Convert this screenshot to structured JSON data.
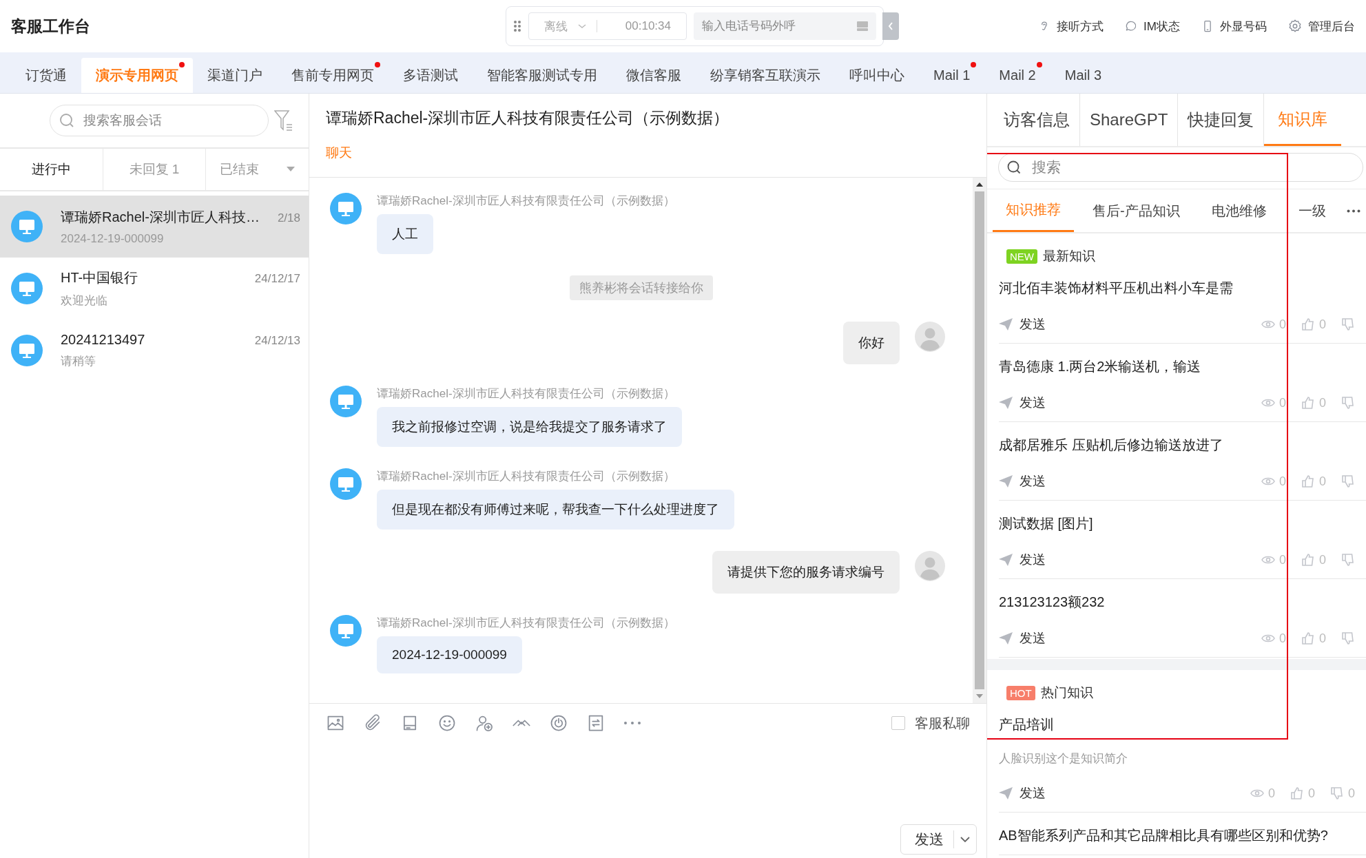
{
  "app_title": "客服工作台",
  "call_bar": {
    "status": "离线",
    "timer": "00:10:34",
    "phone_placeholder": "输入电话号码外呼"
  },
  "header_actions": [
    {
      "kind": "ear",
      "label": "接听方式"
    },
    {
      "kind": "chat",
      "label": "IM状态"
    },
    {
      "kind": "phone",
      "label": "外显号码"
    },
    {
      "kind": "gear",
      "label": "管理后台"
    }
  ],
  "tabs": [
    {
      "label": "订货通",
      "selected": false,
      "unread": false
    },
    {
      "label": "演示专用网页",
      "selected": true,
      "unread": true
    },
    {
      "label": "渠道门户",
      "selected": false,
      "unread": false
    },
    {
      "label": "售前专用网页",
      "selected": false,
      "unread": true
    },
    {
      "label": "多语测试",
      "selected": false,
      "unread": false
    },
    {
      "label": "智能客服测试专用",
      "selected": false,
      "unread": false
    },
    {
      "label": "微信客服",
      "selected": false,
      "unread": false
    },
    {
      "label": "纷享销客互联演示",
      "selected": false,
      "unread": false
    },
    {
      "label": "呼叫中心",
      "selected": false,
      "unread": false
    },
    {
      "label": "Mail 1",
      "selected": false,
      "unread": true
    },
    {
      "label": "Mail 2",
      "selected": false,
      "unread": true
    },
    {
      "label": "Mail 3",
      "selected": false,
      "unread": false
    }
  ],
  "sidebar": {
    "search_placeholder": "搜索客服会话",
    "filters": [
      {
        "label": "进行中",
        "selected": true,
        "dropdown": false
      },
      {
        "label": "未回复 1",
        "selected": false,
        "dropdown": false
      },
      {
        "label": "已结束",
        "selected": false,
        "dropdown": true
      }
    ],
    "conversations": [
      {
        "name": "谭瑞娇Rachel-深圳市匠人科技…",
        "date": "2/18",
        "preview": "2024-12-19-000099",
        "selected": true
      },
      {
        "name": "HT-中国银行",
        "date": "24/12/17",
        "preview": "欢迎光临",
        "selected": false
      },
      {
        "name": "20241213497",
        "date": "24/12/13",
        "preview": "请稍等",
        "selected": false
      }
    ]
  },
  "chat": {
    "title": "谭瑞娇Rachel-深圳市匠人科技有限责任公司（示例数据）",
    "tab": "聊天",
    "messages": [
      {
        "kind": "incoming",
        "sender": "谭瑞娇Rachel-深圳市匠人科技有限责任公司（示例数据）",
        "text": "人工"
      },
      {
        "kind": "system",
        "text": "熊养彬将会话转接给你"
      },
      {
        "kind": "outgoing",
        "text": "你好"
      },
      {
        "kind": "incoming",
        "sender": "谭瑞娇Rachel-深圳市匠人科技有限责任公司（示例数据）",
        "text": "我之前报修过空调，说是给我提交了服务请求了"
      },
      {
        "kind": "incoming",
        "sender": "谭瑞娇Rachel-深圳市匠人科技有限责任公司（示例数据）",
        "text": "但是现在都没有师傅过来呢，帮我查一下什么处理进度了"
      },
      {
        "kind": "outgoing",
        "text": "请提供下您的服务请求编号"
      },
      {
        "kind": "incoming",
        "sender": "谭瑞娇Rachel-深圳市匠人科技有限责任公司（示例数据）",
        "text": "2024-12-19-000099"
      }
    ],
    "private_chat": {
      "label": "客服私聊",
      "checked": false
    },
    "send_label": "发送"
  },
  "side_panel": {
    "tabs": [
      {
        "label": "访客信息",
        "selected": false
      },
      {
        "label": "ShareGPT",
        "selected": false
      },
      {
        "label": "快捷回复",
        "selected": false
      },
      {
        "label": "知识库",
        "selected": true
      }
    ],
    "search_placeholder": "搜索",
    "categories": [
      {
        "label": "知识推荐",
        "selected": true
      },
      {
        "label": "售后-产品知识",
        "selected": false
      },
      {
        "label": "电池维修",
        "selected": false
      },
      {
        "label": "一级",
        "selected": false
      }
    ],
    "sections": [
      {
        "kind": "new",
        "badge": "NEW",
        "title": "最新知识",
        "items": [
          {
            "title": "河北佰丰装饰材料平压机出料小车是需",
            "send": "发送",
            "views": "0",
            "likes": "0"
          },
          {
            "title": "青岛德康 1.两台2米输送机，输送",
            "send": "发送",
            "views": "0",
            "likes": "0"
          },
          {
            "title": "成都居雅乐 压贴机后修边输送放进了",
            "send": "发送",
            "views": "0",
            "likes": "0"
          },
          {
            "title": "测试数据 [图片]",
            "send": "发送",
            "views": "0",
            "likes": "0"
          },
          {
            "title": "213123123额232",
            "send": "发送",
            "views": "0",
            "likes": "0"
          }
        ]
      },
      {
        "kind": "hot",
        "badge": "HOT",
        "title": "热门知识",
        "items": [
          {
            "title": "产品培训",
            "summary": "人脸识别这个是知识简介",
            "send": "发送",
            "views": "0",
            "likes": "0",
            "dislikes": "0"
          },
          {
            "title": "AB智能系列产品和其它品牌相比具有哪些区别和优势?"
          }
        ]
      }
    ]
  }
}
